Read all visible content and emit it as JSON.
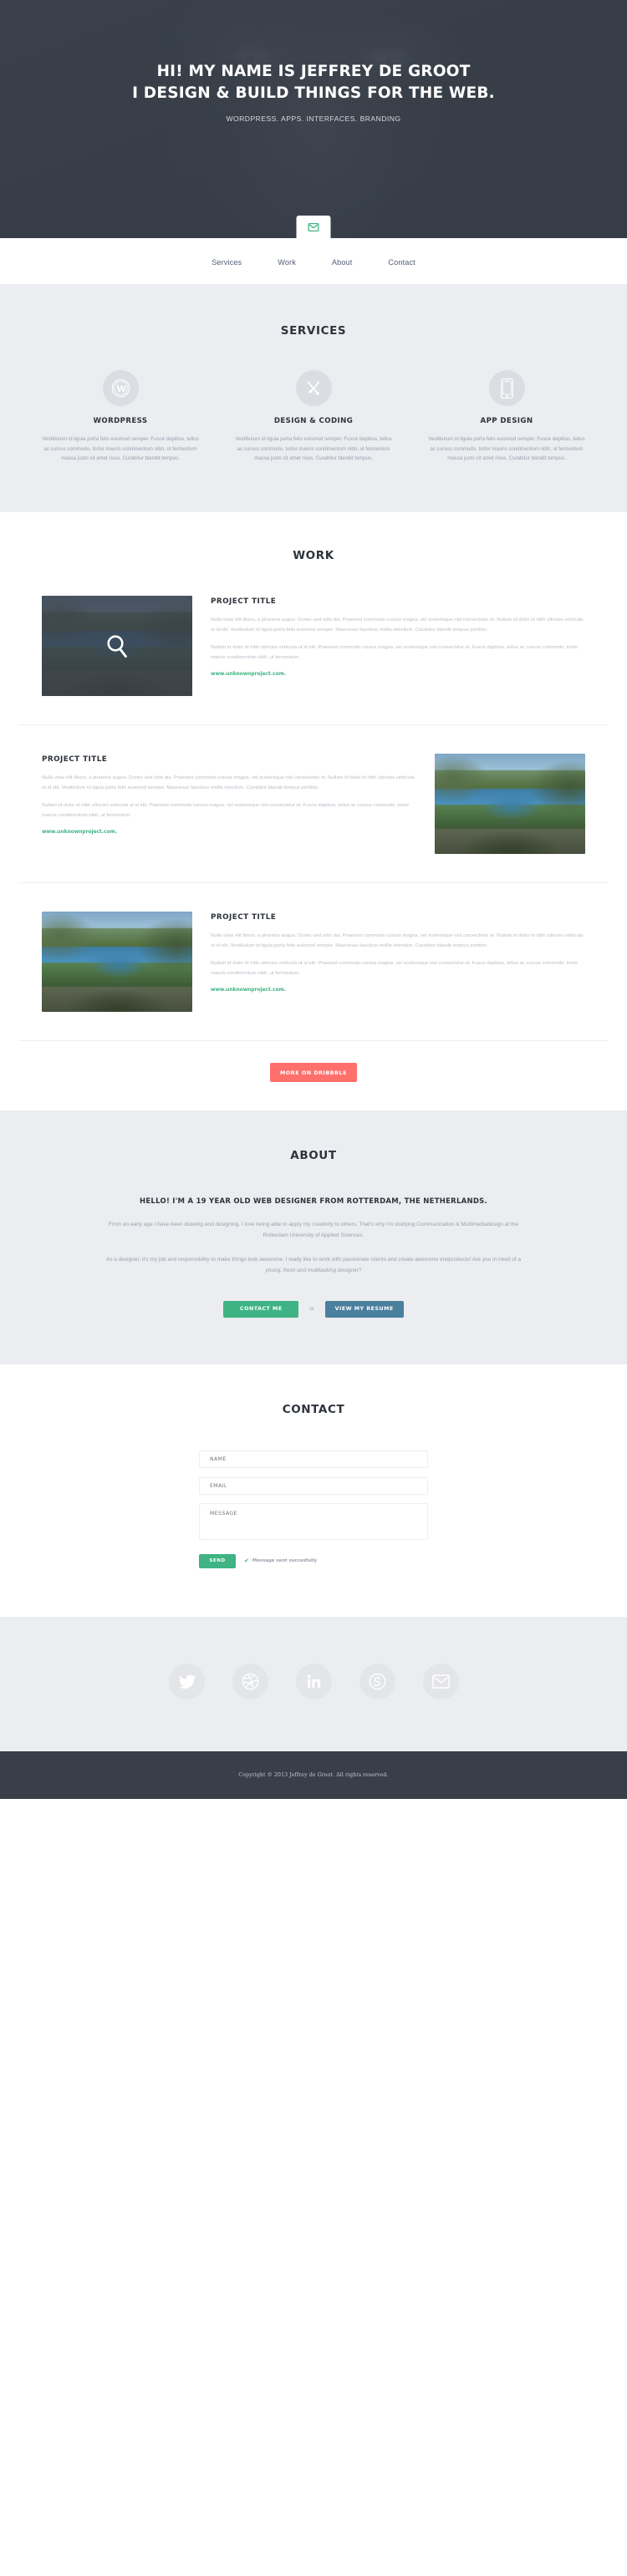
{
  "hero": {
    "headline_line1": "HI! MY NAME IS JEFFREY DE GROOT",
    "headline_line2": "I DESIGN & BUILD THINGS FOR THE WEB.",
    "subtitle": "WORDPRESS. APPS. INTERFACES. BRANDING",
    "tab_icon": "envelope-icon",
    "bg_color": "#383f49",
    "accent_green": "#3fb383"
  },
  "nav": {
    "items": [
      {
        "label": "Services"
      },
      {
        "label": "Work"
      },
      {
        "label": "About"
      },
      {
        "label": "Contact"
      }
    ]
  },
  "services": {
    "title": "SERVICES",
    "items": [
      {
        "icon": "wordpress-icon",
        "name": "WORDPRESS",
        "desc": "Vestibulum id ligula porta felis euismod semper. Fusce dapibus, tellus ac cursus commodo, tortor mauris condimentum nibh, ut fermentum massa justo sit amet risus. Curabitur blandit tempus."
      },
      {
        "icon": "brush-pencil-icon",
        "name": "DESIGN & CODING",
        "desc": "Vestibulum id ligula porta felis euismod semper. Fusce dapibus, tellus ac cursus commodo, tortor mauris condimentum nibh, ut fermentum massa justo sit amet risus. Curabitur blandit tempus."
      },
      {
        "icon": "mobile-phone-icon",
        "name": "APP DESIGN",
        "desc": "Vestibulum id ligula porta felis euismod semper. Fusce dapibus, tellus ac cursus commodo, tortor mauris condimentum nibh, ut fermentum massa justo sit amet risus. Curabitur blandit tempus."
      }
    ]
  },
  "work": {
    "title": "WORK",
    "projects": [
      {
        "title": "PROJECT TITLE",
        "p1": "Nulla vitae elit libero, a pharetra augue. Donec sed odio dui. Praesent commodo cursus magna, vel scelerisque nisl consectetur et. Nullam id dolor id nibh ultricies vehicula ut id elit. Vestibulum id ligula porta felis euismod semper. Maecenas faucibus mollis interdum. Curabitur blandit tempus porttitor.",
        "p2": "Nullam id dolor id nibh ultricies vehicula ut id elit. Praesent commodo cursus magna, vel scelerisque nisl consectetur et. Fusce dapibus, tellus ac cursus commodo, tortor mauris condimentum nibh, ut fermentum.",
        "link": "www.unknownproject.com.",
        "image_position": "left",
        "hover": true
      },
      {
        "title": "PROJECT TITLE",
        "p1": "Nulla vitae elit libero, a pharetra augue. Donec sed odio dui. Praesent commodo cursus magna, vel scelerisque nisl consectetur et. Nullam id dolor id nibh ultricies vehicula ut id elit. Vestibulum id ligula porta felis euismod semper. Maecenas faucibus mollis interdum. Curabitur blandit tempus porttitor.",
        "p2": "Nullam id dolor id nibh ultricies vehicula ut id elit. Praesent commodo cursus magna, vel scelerisque nisl consectetur et. Fusce dapibus, tellus ac cursus commodo, tortor mauris condimentum nibh, ut fermentum.",
        "link": "www.unknownproject.com.",
        "image_position": "right",
        "hover": false
      },
      {
        "title": "PROJECT TITLE",
        "p1": "Nulla vitae elit libero, a pharetra augue. Donec sed odio dui. Praesent commodo cursus magna, vel scelerisque nisl consectetur et. Nullam id dolor id nibh ultricies vehicula ut id elit. Vestibulum id ligula porta felis euismod semper. Maecenas faucibus mollis interdum. Curabitur blandit tempus porttitor.",
        "p2": "Nullam id dolor id nibh ultricies vehicula ut id elit. Praesent commodo cursus magna, vel scelerisque nisl consectetur et. Fusce dapibus, tellus ac cursus commodo, tortor mauris condimentum nibh, ut fermentum.",
        "link": "www.unknownproject.com.",
        "image_position": "left",
        "hover": false
      }
    ],
    "more_button": "MORE ON DRIBBBLE",
    "more_button_color": "#ff6f6b"
  },
  "about": {
    "title": "ABOUT",
    "lead": "HELLO! I'M A 19 YEAR OLD WEB DESIGNER FROM ROTTERDAM, THE NETHERLANDS.",
    "p1": "From an early age I have been drawing and designing. I love being able to apply my creativity to others. That's why I'm studying Communication & Multimediadesign at the Rotterdam University of Applied Sciences.",
    "p2_a": "As a designer, it's my job and responsibility to make things look awesome. I really like to work with passionate clients and create awesome endproducts! Are you in need of a ",
    "p2_em1": "young, fresh",
    "p2_b": " and ",
    "p2_em2": "multitasking",
    "p2_c": " designer?",
    "contact_button": "CONTACT ME",
    "or_label": "or",
    "resume_button": "VIEW  MY RESUME",
    "contact_button_color": "#3fb383",
    "resume_button_color": "#4b7f9e"
  },
  "contact": {
    "title": "CONTACT",
    "name_placeholder": "NAME",
    "email_placeholder": "EMAIL",
    "message_placeholder": "MESSAGE",
    "send_button": "SEND",
    "status_text": "Message sent succesfully",
    "status_icon": "check-icon"
  },
  "social": {
    "items": [
      {
        "icon": "twitter-icon",
        "name": "Twitter"
      },
      {
        "icon": "dribbble-icon",
        "name": "Dribbble"
      },
      {
        "icon": "linkedin-icon",
        "name": "LinkedIn"
      },
      {
        "icon": "skype-icon",
        "name": "Skype"
      },
      {
        "icon": "envelope-icon",
        "name": "Email"
      }
    ]
  },
  "footer": {
    "copyright": "Copyright © 2013 Jeffrey de Groot. All rights reserved."
  }
}
